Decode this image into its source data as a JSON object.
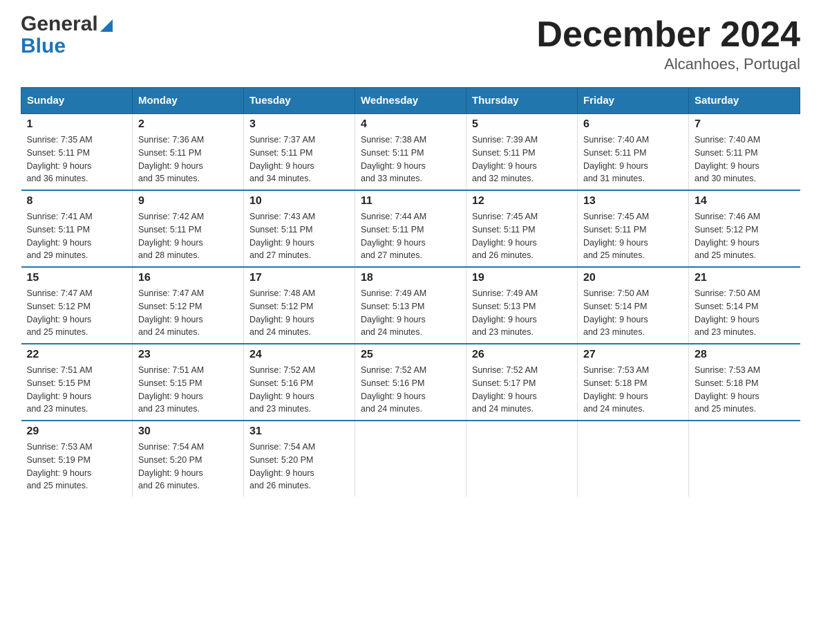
{
  "header": {
    "logo_general": "General",
    "logo_blue": "Blue",
    "month_title": "December 2024",
    "location": "Alcanhoes, Portugal"
  },
  "days_of_week": [
    "Sunday",
    "Monday",
    "Tuesday",
    "Wednesday",
    "Thursday",
    "Friday",
    "Saturday"
  ],
  "weeks": [
    [
      {
        "day": "1",
        "sunrise": "7:35 AM",
        "sunset": "5:11 PM",
        "daylight": "9 hours and 36 minutes."
      },
      {
        "day": "2",
        "sunrise": "7:36 AM",
        "sunset": "5:11 PM",
        "daylight": "9 hours and 35 minutes."
      },
      {
        "day": "3",
        "sunrise": "7:37 AM",
        "sunset": "5:11 PM",
        "daylight": "9 hours and 34 minutes."
      },
      {
        "day": "4",
        "sunrise": "7:38 AM",
        "sunset": "5:11 PM",
        "daylight": "9 hours and 33 minutes."
      },
      {
        "day": "5",
        "sunrise": "7:39 AM",
        "sunset": "5:11 PM",
        "daylight": "9 hours and 32 minutes."
      },
      {
        "day": "6",
        "sunrise": "7:40 AM",
        "sunset": "5:11 PM",
        "daylight": "9 hours and 31 minutes."
      },
      {
        "day": "7",
        "sunrise": "7:40 AM",
        "sunset": "5:11 PM",
        "daylight": "9 hours and 30 minutes."
      }
    ],
    [
      {
        "day": "8",
        "sunrise": "7:41 AM",
        "sunset": "5:11 PM",
        "daylight": "9 hours and 29 minutes."
      },
      {
        "day": "9",
        "sunrise": "7:42 AM",
        "sunset": "5:11 PM",
        "daylight": "9 hours and 28 minutes."
      },
      {
        "day": "10",
        "sunrise": "7:43 AM",
        "sunset": "5:11 PM",
        "daylight": "9 hours and 27 minutes."
      },
      {
        "day": "11",
        "sunrise": "7:44 AM",
        "sunset": "5:11 PM",
        "daylight": "9 hours and 27 minutes."
      },
      {
        "day": "12",
        "sunrise": "7:45 AM",
        "sunset": "5:11 PM",
        "daylight": "9 hours and 26 minutes."
      },
      {
        "day": "13",
        "sunrise": "7:45 AM",
        "sunset": "5:11 PM",
        "daylight": "9 hours and 25 minutes."
      },
      {
        "day": "14",
        "sunrise": "7:46 AM",
        "sunset": "5:12 PM",
        "daylight": "9 hours and 25 minutes."
      }
    ],
    [
      {
        "day": "15",
        "sunrise": "7:47 AM",
        "sunset": "5:12 PM",
        "daylight": "9 hours and 25 minutes."
      },
      {
        "day": "16",
        "sunrise": "7:47 AM",
        "sunset": "5:12 PM",
        "daylight": "9 hours and 24 minutes."
      },
      {
        "day": "17",
        "sunrise": "7:48 AM",
        "sunset": "5:12 PM",
        "daylight": "9 hours and 24 minutes."
      },
      {
        "day": "18",
        "sunrise": "7:49 AM",
        "sunset": "5:13 PM",
        "daylight": "9 hours and 24 minutes."
      },
      {
        "day": "19",
        "sunrise": "7:49 AM",
        "sunset": "5:13 PM",
        "daylight": "9 hours and 23 minutes."
      },
      {
        "day": "20",
        "sunrise": "7:50 AM",
        "sunset": "5:14 PM",
        "daylight": "9 hours and 23 minutes."
      },
      {
        "day": "21",
        "sunrise": "7:50 AM",
        "sunset": "5:14 PM",
        "daylight": "9 hours and 23 minutes."
      }
    ],
    [
      {
        "day": "22",
        "sunrise": "7:51 AM",
        "sunset": "5:15 PM",
        "daylight": "9 hours and 23 minutes."
      },
      {
        "day": "23",
        "sunrise": "7:51 AM",
        "sunset": "5:15 PM",
        "daylight": "9 hours and 23 minutes."
      },
      {
        "day": "24",
        "sunrise": "7:52 AM",
        "sunset": "5:16 PM",
        "daylight": "9 hours and 23 minutes."
      },
      {
        "day": "25",
        "sunrise": "7:52 AM",
        "sunset": "5:16 PM",
        "daylight": "9 hours and 24 minutes."
      },
      {
        "day": "26",
        "sunrise": "7:52 AM",
        "sunset": "5:17 PM",
        "daylight": "9 hours and 24 minutes."
      },
      {
        "day": "27",
        "sunrise": "7:53 AM",
        "sunset": "5:18 PM",
        "daylight": "9 hours and 24 minutes."
      },
      {
        "day": "28",
        "sunrise": "7:53 AM",
        "sunset": "5:18 PM",
        "daylight": "9 hours and 25 minutes."
      }
    ],
    [
      {
        "day": "29",
        "sunrise": "7:53 AM",
        "sunset": "5:19 PM",
        "daylight": "9 hours and 25 minutes."
      },
      {
        "day": "30",
        "sunrise": "7:54 AM",
        "sunset": "5:20 PM",
        "daylight": "9 hours and 26 minutes."
      },
      {
        "day": "31",
        "sunrise": "7:54 AM",
        "sunset": "5:20 PM",
        "daylight": "9 hours and 26 minutes."
      },
      {
        "day": "",
        "sunrise": "",
        "sunset": "",
        "daylight": ""
      },
      {
        "day": "",
        "sunrise": "",
        "sunset": "",
        "daylight": ""
      },
      {
        "day": "",
        "sunrise": "",
        "sunset": "",
        "daylight": ""
      },
      {
        "day": "",
        "sunrise": "",
        "sunset": "",
        "daylight": ""
      }
    ]
  ],
  "labels": {
    "sunrise_prefix": "Sunrise: ",
    "sunset_prefix": "Sunset: ",
    "daylight_prefix": "Daylight: "
  }
}
